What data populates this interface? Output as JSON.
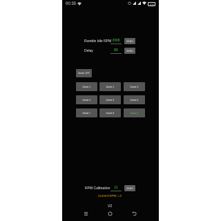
{
  "status_bar": {
    "time": "00:35",
    "notif_icon": "wifi-signal-icon",
    "battery": "100"
  },
  "rumble": {
    "label": "Rumble Idle RPM",
    "value": "2000",
    "send_label": "SEND"
  },
  "delay": {
    "label": "Delay",
    "value": "80",
    "send_label": "SEND"
  },
  "mode_off_label": "Mode OFF",
  "modes": [
    "Mode 1",
    "Mode 2",
    "Mode 3",
    "Mode 4",
    "Mode 5",
    "Mode 6",
    "Mode 7",
    "Mode 8",
    "Mode 9"
  ],
  "active_mode_index": 8,
  "calibration": {
    "label": "RPM Calibration",
    "value": "11",
    "send_label": "SEND"
  },
  "current_rpm": "Current RPM = 0",
  "version": "V2",
  "nav_bar": {
    "menu_icon": "menu-icon",
    "home_icon": "home-icon",
    "back_icon": "back-icon"
  },
  "colors": {
    "background": "#050505",
    "button": "#555555",
    "value_green": "#3bd13b",
    "rpm_orange": "#f0a800"
  }
}
